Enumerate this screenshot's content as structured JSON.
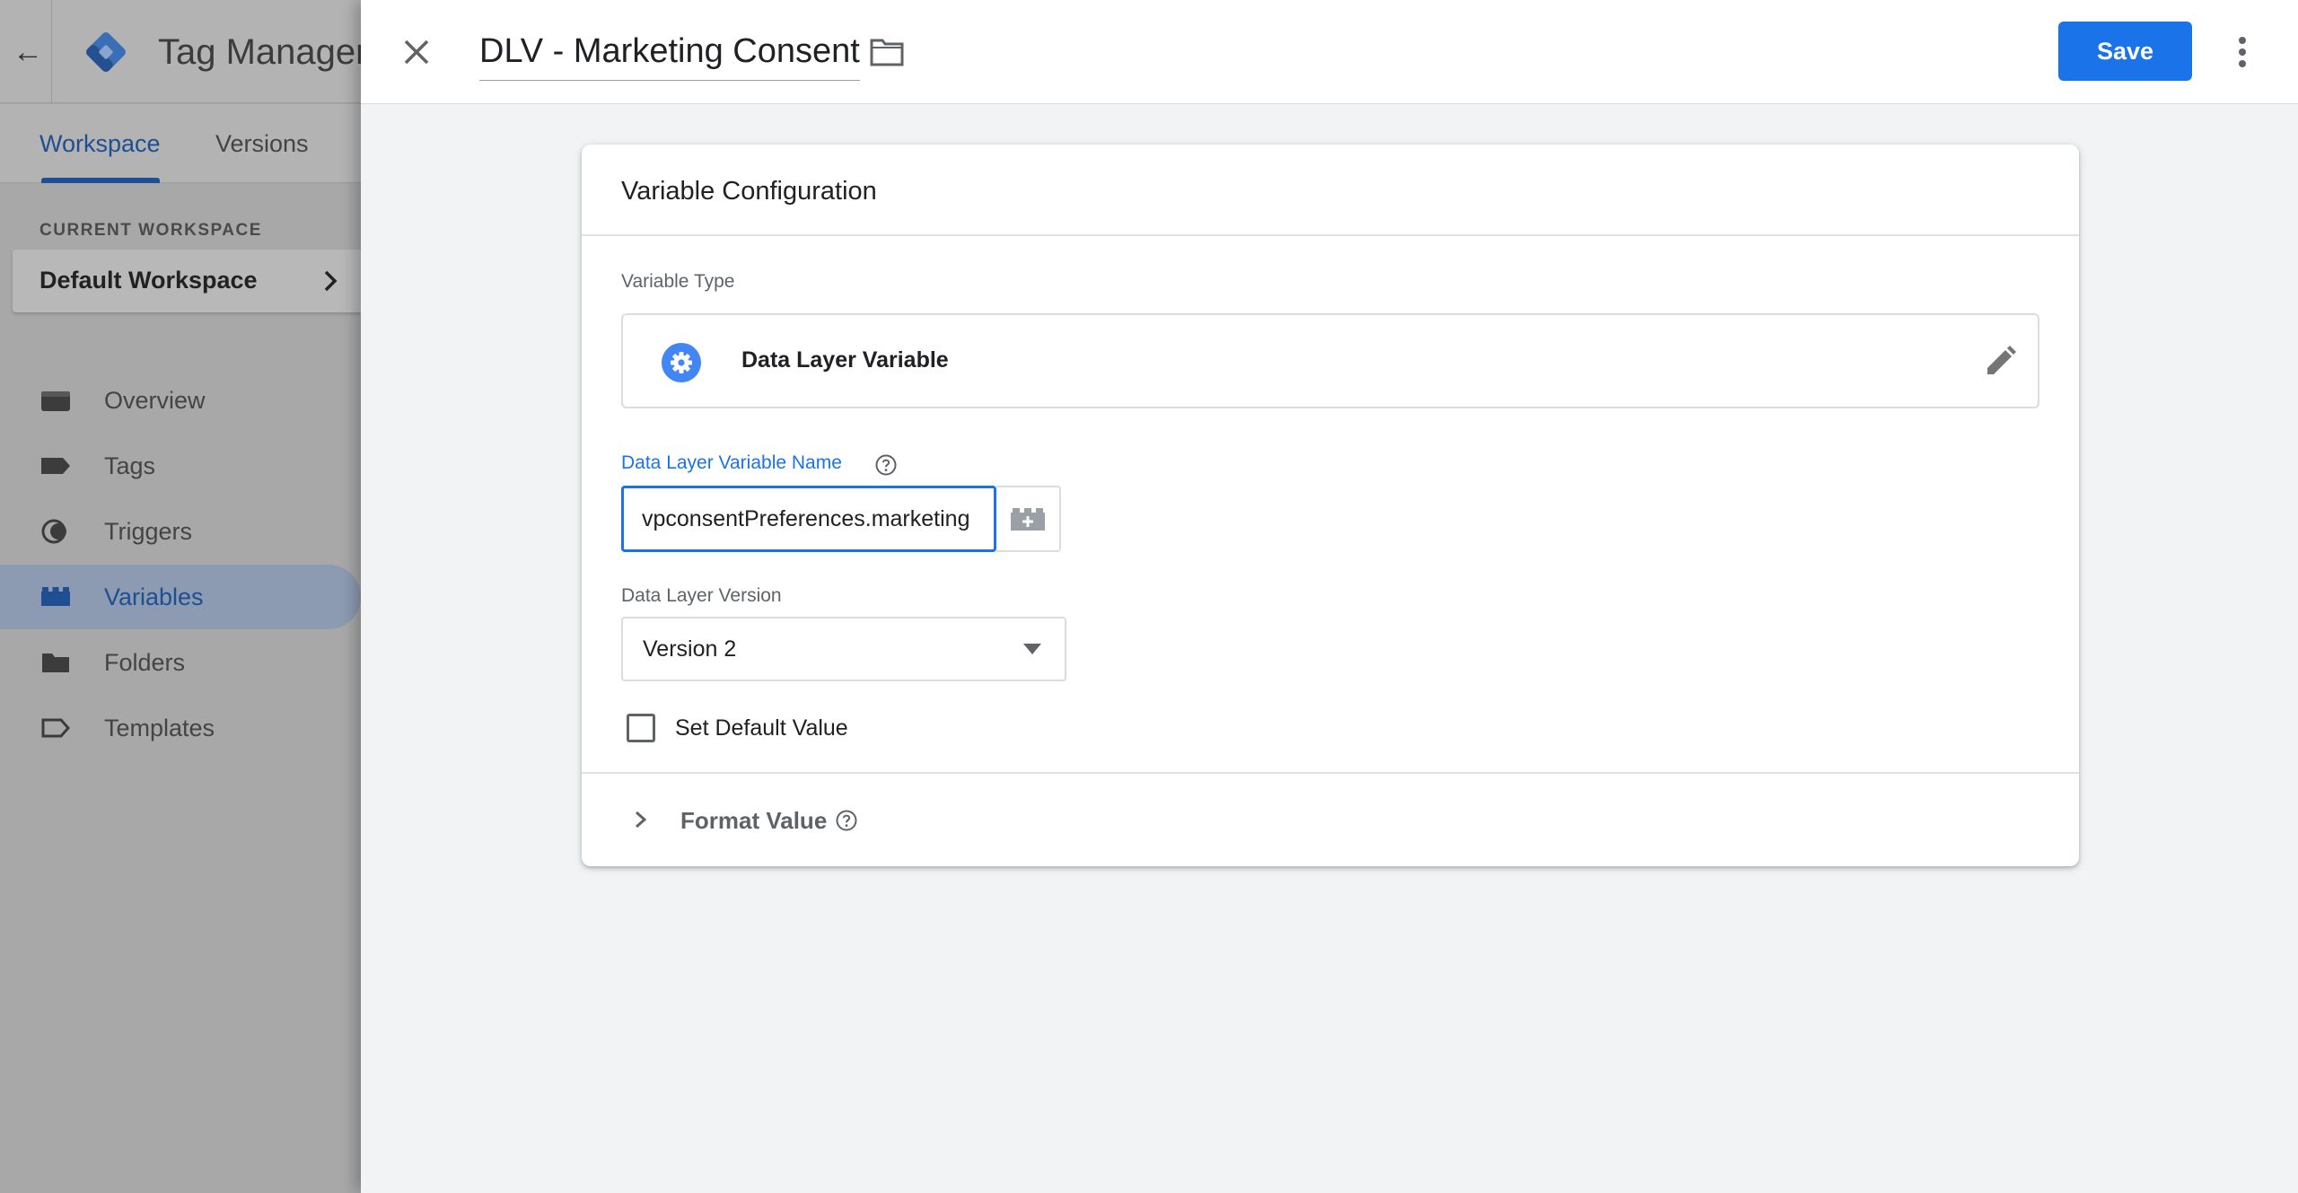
{
  "app": {
    "title": "Tag Manager",
    "back_icon": "arrow-back-icon"
  },
  "tabs": [
    {
      "label": "Workspace",
      "active": true
    },
    {
      "label": "Versions",
      "active": false
    }
  ],
  "workspace": {
    "section_label": "CURRENT WORKSPACE",
    "name": "Default Workspace"
  },
  "nav": [
    {
      "label": "Overview",
      "icon": "overview-icon",
      "active": false
    },
    {
      "label": "Tags",
      "icon": "tag-icon",
      "active": false
    },
    {
      "label": "Triggers",
      "icon": "trigger-icon",
      "active": false
    },
    {
      "label": "Variables",
      "icon": "variables-icon",
      "active": true
    },
    {
      "label": "Folders",
      "icon": "folder-icon",
      "active": false
    },
    {
      "label": "Templates",
      "icon": "template-icon",
      "active": false
    }
  ],
  "editor": {
    "variable_name": "DLV - Marketing Consent",
    "save_label": "Save",
    "card_title": "Variable Configuration",
    "variable_type_label": "Variable Type",
    "variable_type": "Data Layer Variable",
    "dlv_name_label": "Data Layer Variable Name",
    "dlv_name_value": "vpconsentPreferences.marketing",
    "dlv_version_label": "Data Layer Version",
    "dlv_version_value": "Version 2",
    "default_value_label": "Set Default Value",
    "default_value_checked": false,
    "format_value_label": "Format Value"
  },
  "colors": {
    "primary": "#1a73e8",
    "text": "#202124",
    "muted": "#5f6368",
    "dimmed_sidebar": "#a8a8a8"
  }
}
